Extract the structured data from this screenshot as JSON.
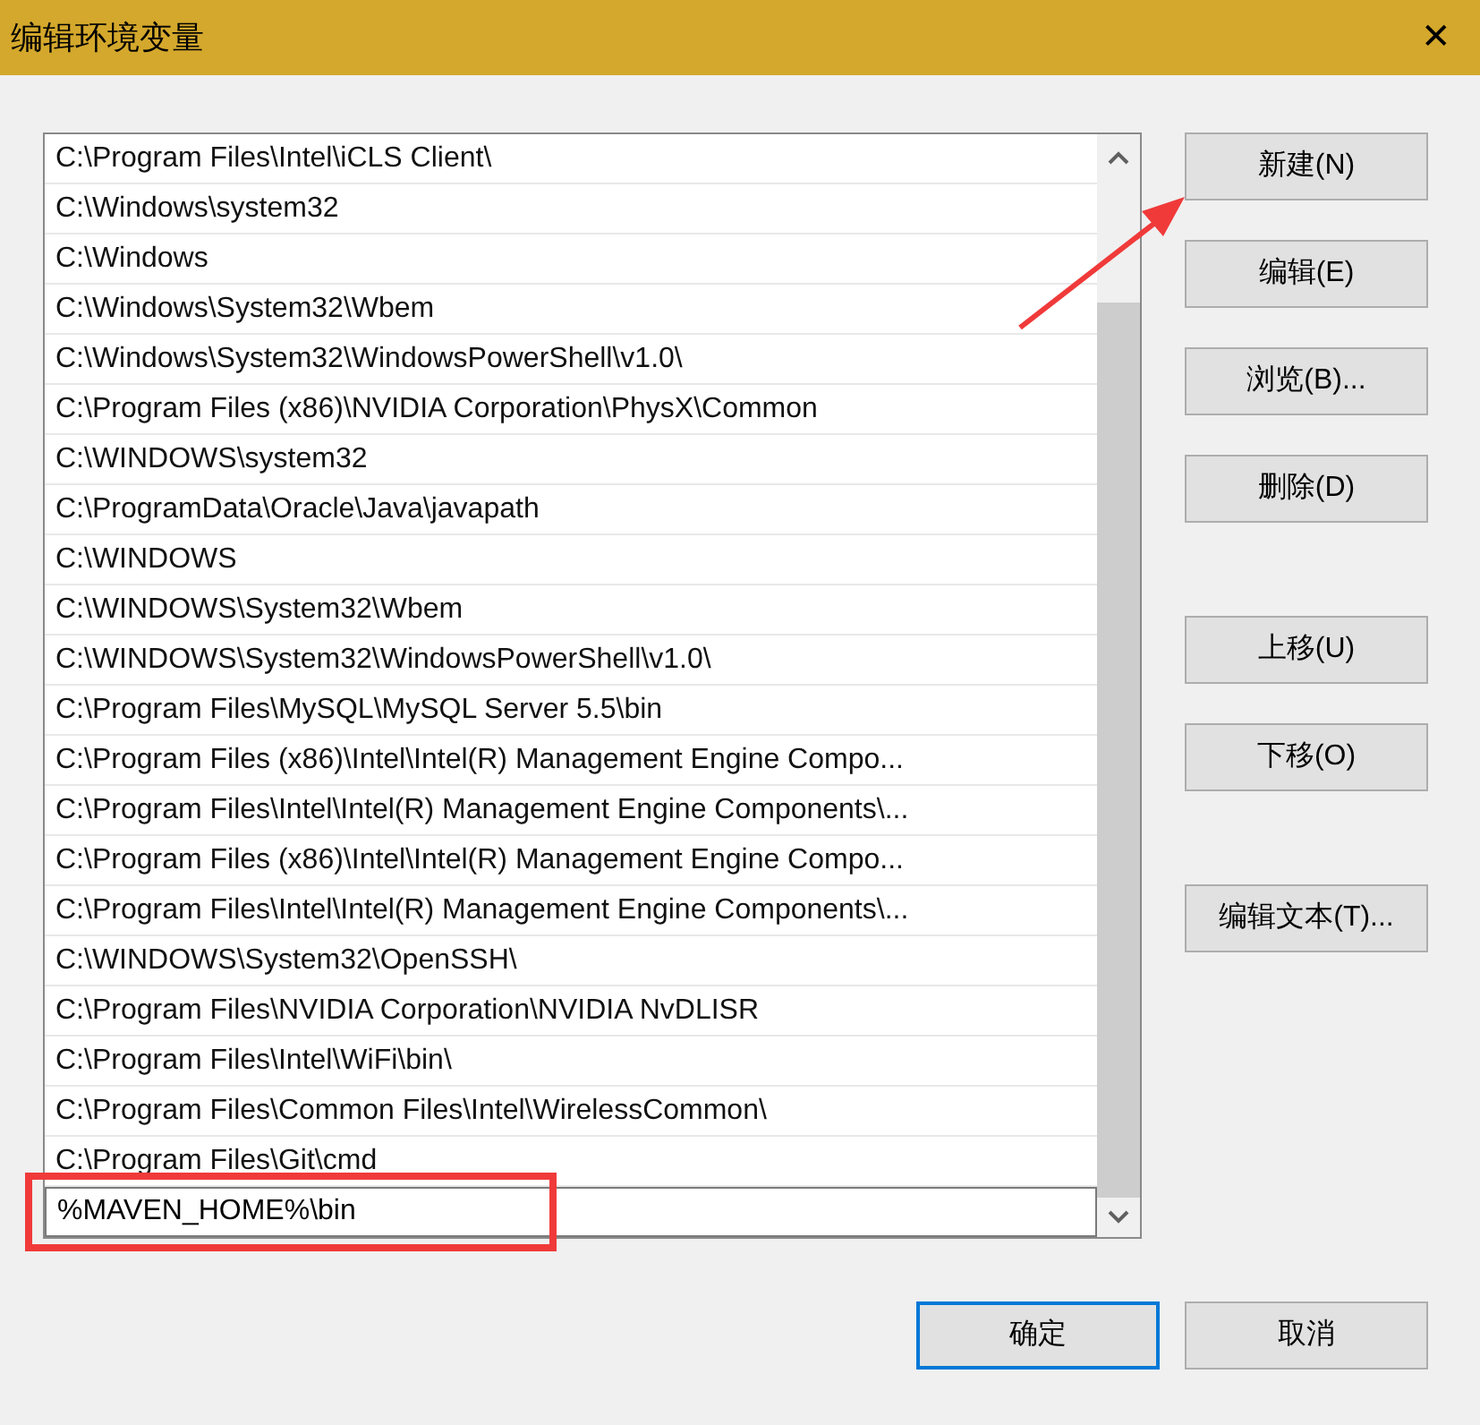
{
  "window": {
    "title": "编辑环境变量",
    "close": "✕"
  },
  "entries": [
    {
      "text": "C:\\Program Files\\Intel\\iCLS Client\\",
      "editing": false,
      "highlighted": false
    },
    {
      "text": "C:\\Windows\\system32",
      "editing": false,
      "highlighted": false
    },
    {
      "text": "C:\\Windows",
      "editing": false,
      "highlighted": false
    },
    {
      "text": "C:\\Windows\\System32\\Wbem",
      "editing": false,
      "highlighted": false
    },
    {
      "text": "C:\\Windows\\System32\\WindowsPowerShell\\v1.0\\",
      "editing": false,
      "highlighted": false
    },
    {
      "text": "C:\\Program Files (x86)\\NVIDIA Corporation\\PhysX\\Common",
      "editing": false,
      "highlighted": false
    },
    {
      "text": "C:\\WINDOWS\\system32",
      "editing": false,
      "highlighted": false
    },
    {
      "text": "C:\\ProgramData\\Oracle\\Java\\javapath",
      "editing": false,
      "highlighted": false
    },
    {
      "text": "C:\\WINDOWS",
      "editing": false,
      "highlighted": false
    },
    {
      "text": "C:\\WINDOWS\\System32\\Wbem",
      "editing": false,
      "highlighted": false
    },
    {
      "text": "C:\\WINDOWS\\System32\\WindowsPowerShell\\v1.0\\",
      "editing": false,
      "highlighted": false
    },
    {
      "text": "C:\\Program Files\\MySQL\\MySQL Server 5.5\\bin",
      "editing": false,
      "highlighted": false
    },
    {
      "text": "C:\\Program Files (x86)\\Intel\\Intel(R) Management Engine Compo...",
      "editing": false,
      "highlighted": false
    },
    {
      "text": "C:\\Program Files\\Intel\\Intel(R) Management Engine Components\\...",
      "editing": false,
      "highlighted": false
    },
    {
      "text": "C:\\Program Files (x86)\\Intel\\Intel(R) Management Engine Compo...",
      "editing": false,
      "highlighted": false
    },
    {
      "text": "C:\\Program Files\\Intel\\Intel(R) Management Engine Components\\...",
      "editing": false,
      "highlighted": false
    },
    {
      "text": "C:\\WINDOWS\\System32\\OpenSSH\\",
      "editing": false,
      "highlighted": false
    },
    {
      "text": "C:\\Program Files\\NVIDIA Corporation\\NVIDIA NvDLISR",
      "editing": false,
      "highlighted": false
    },
    {
      "text": "C:\\Program Files\\Intel\\WiFi\\bin\\",
      "editing": false,
      "highlighted": false
    },
    {
      "text": "C:\\Program Files\\Common Files\\Intel\\WirelessCommon\\",
      "editing": false,
      "highlighted": false
    },
    {
      "text": "C:\\Program Files\\Git\\cmd",
      "editing": false,
      "highlighted": false
    },
    {
      "text": "%MAVEN_HOME%\\bin",
      "editing": true,
      "highlighted": true
    }
  ],
  "side_button_groups": [
    [
      "新建(N)",
      "编辑(E)",
      "浏览(B)...",
      "删除(D)"
    ],
    [
      "上移(U)",
      "下移(O)"
    ],
    [
      "编辑文本(T)..."
    ]
  ],
  "footer_buttons": [
    {
      "label": "确定",
      "default": true
    },
    {
      "label": "取消",
      "default": false
    }
  ]
}
